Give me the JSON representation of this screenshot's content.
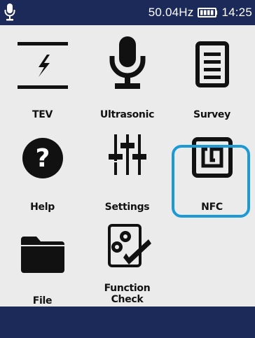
{
  "status_bar": {
    "frequency": "50.04Hz",
    "time": "14:25",
    "icons": [
      "microphone-icon",
      "battery-icon"
    ]
  },
  "menu": {
    "items": [
      {
        "label": "TEV",
        "icon": "tev-icon"
      },
      {
        "label": "Ultrasonic",
        "icon": "microphone-icon"
      },
      {
        "label": "Survey",
        "icon": "document-icon"
      },
      {
        "label": "Help",
        "icon": "question-icon"
      },
      {
        "label": "Settings",
        "icon": "sliders-icon"
      },
      {
        "label": "NFC",
        "icon": "nfc-icon",
        "selected": true
      },
      {
        "label": "File",
        "icon": "folder-icon"
      },
      {
        "label": "Function\nCheck",
        "icon": "gear-check-icon"
      }
    ]
  },
  "colors": {
    "bar": "#1c2a5a",
    "background": "#ebebeb",
    "selection": "#1d9ad6",
    "icon": "#111111"
  }
}
